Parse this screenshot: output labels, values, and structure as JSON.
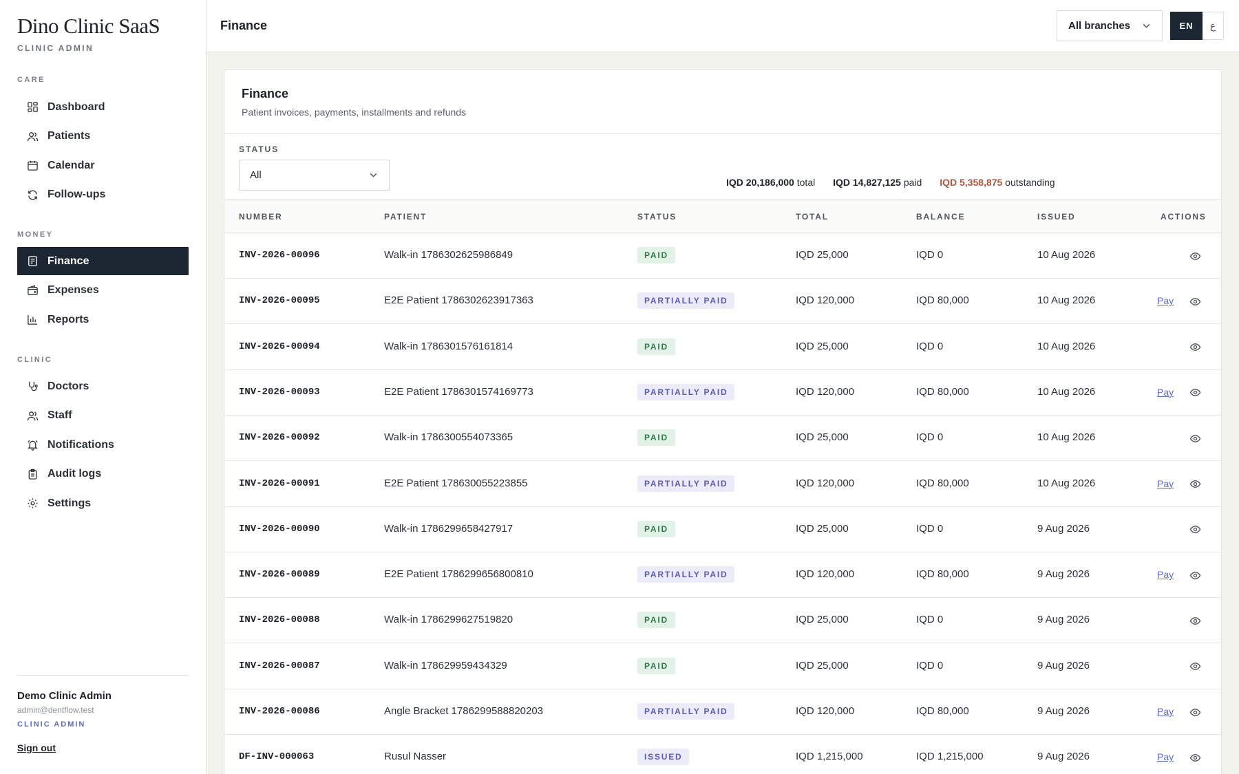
{
  "app": {
    "brand": "Dino Clinic SaaS",
    "brand_sub": "CLINIC ADMIN"
  },
  "sidebar": {
    "sections": [
      {
        "label": "CARE",
        "items": [
          {
            "label": "Dashboard",
            "icon": "dashboard-icon"
          },
          {
            "label": "Patients",
            "icon": "users-icon"
          },
          {
            "label": "Calendar",
            "icon": "calendar-icon"
          },
          {
            "label": "Follow-ups",
            "icon": "refresh-icon"
          }
        ]
      },
      {
        "label": "MONEY",
        "items": [
          {
            "label": "Finance",
            "icon": "invoice-icon",
            "active": true
          },
          {
            "label": "Expenses",
            "icon": "wallet-icon"
          },
          {
            "label": "Reports",
            "icon": "bar-chart-icon"
          }
        ]
      },
      {
        "label": "CLINIC",
        "items": [
          {
            "label": "Doctors",
            "icon": "stethoscope-icon"
          },
          {
            "label": "Staff",
            "icon": "users-icon"
          },
          {
            "label": "Notifications",
            "icon": "bell-icon"
          },
          {
            "label": "Audit logs",
            "icon": "clipboard-icon"
          },
          {
            "label": "Settings",
            "icon": "gear-icon"
          }
        ]
      }
    ],
    "user": {
      "name": "Demo Clinic Admin",
      "email": "admin@dentflow.test",
      "role": "CLINIC ADMIN",
      "sign_out": "Sign out"
    }
  },
  "topbar": {
    "title": "Finance",
    "branch_select": "All branches",
    "lang_en": "EN",
    "lang_ar": "ع"
  },
  "card": {
    "title": "Finance",
    "subtitle": "Patient invoices, payments, installments and refunds",
    "filter_label": "STATUS",
    "filter_value": "All",
    "totals": {
      "total_value": "IQD 20,186,000",
      "total_label": "total",
      "paid_value": "IQD 14,827,125",
      "paid_label": "paid",
      "outstanding_value": "IQD 5,358,875",
      "outstanding_label": "outstanding"
    }
  },
  "table": {
    "columns": [
      "NUMBER",
      "PATIENT",
      "STATUS",
      "TOTAL",
      "BALANCE",
      "ISSUED",
      "ACTIONS"
    ],
    "pay_label": "Pay",
    "rows": [
      {
        "number": "INV-2026-00096",
        "patient": "Walk-in 1786302625986849",
        "status": "PAID",
        "total": "IQD 25,000",
        "balance": "IQD 0",
        "issued": "10 Aug 2026",
        "pay": false
      },
      {
        "number": "INV-2026-00095",
        "patient": "E2E Patient 1786302623917363",
        "status": "PARTIALLY PAID",
        "total": "IQD 120,000",
        "balance": "IQD 80,000",
        "issued": "10 Aug 2026",
        "pay": true
      },
      {
        "number": "INV-2026-00094",
        "patient": "Walk-in 1786301576161814",
        "status": "PAID",
        "total": "IQD 25,000",
        "balance": "IQD 0",
        "issued": "10 Aug 2026",
        "pay": false
      },
      {
        "number": "INV-2026-00093",
        "patient": "E2E Patient 1786301574169773",
        "status": "PARTIALLY PAID",
        "total": "IQD 120,000",
        "balance": "IQD 80,000",
        "issued": "10 Aug 2026",
        "pay": true
      },
      {
        "number": "INV-2026-00092",
        "patient": "Walk-in 1786300554073365",
        "status": "PAID",
        "total": "IQD 25,000",
        "balance": "IQD 0",
        "issued": "10 Aug 2026",
        "pay": false
      },
      {
        "number": "INV-2026-00091",
        "patient": "E2E Patient 178630055223855",
        "status": "PARTIALLY PAID",
        "total": "IQD 120,000",
        "balance": "IQD 80,000",
        "issued": "10 Aug 2026",
        "pay": true
      },
      {
        "number": "INV-2026-00090",
        "patient": "Walk-in 1786299658427917",
        "status": "PAID",
        "total": "IQD 25,000",
        "balance": "IQD 0",
        "issued": "9 Aug 2026",
        "pay": false
      },
      {
        "number": "INV-2026-00089",
        "patient": "E2E Patient 1786299656800810",
        "status": "PARTIALLY PAID",
        "total": "IQD 120,000",
        "balance": "IQD 80,000",
        "issued": "9 Aug 2026",
        "pay": true
      },
      {
        "number": "INV-2026-00088",
        "patient": "Walk-in 1786299627519820",
        "status": "PAID",
        "total": "IQD 25,000",
        "balance": "IQD 0",
        "issued": "9 Aug 2026",
        "pay": false
      },
      {
        "number": "INV-2026-00087",
        "patient": "Walk-in 178629959434329",
        "status": "PAID",
        "total": "IQD 25,000",
        "balance": "IQD 0",
        "issued": "9 Aug 2026",
        "pay": false
      },
      {
        "number": "INV-2026-00086",
        "patient": "Angle Bracket 1786299588820203",
        "status": "PARTIALLY PAID",
        "total": "IQD 120,000",
        "balance": "IQD 80,000",
        "issued": "9 Aug 2026",
        "pay": true
      },
      {
        "number": "DF-INV-000063",
        "patient": "Rusul Nasser",
        "status": "ISSUED",
        "total": "IQD 1,215,000",
        "balance": "IQD 1,215,000",
        "issued": "9 Aug 2026",
        "pay": true
      }
    ]
  },
  "colors": {
    "accent_dark": "#1c2733",
    "paid_badge_bg": "#e3f2e7",
    "paid_badge_fg": "#2f7a4a",
    "partial_badge_bg": "#ecebfa",
    "partial_badge_fg": "#5b5ab8",
    "outstanding": "#b5533a",
    "link": "#5b6ad0"
  }
}
